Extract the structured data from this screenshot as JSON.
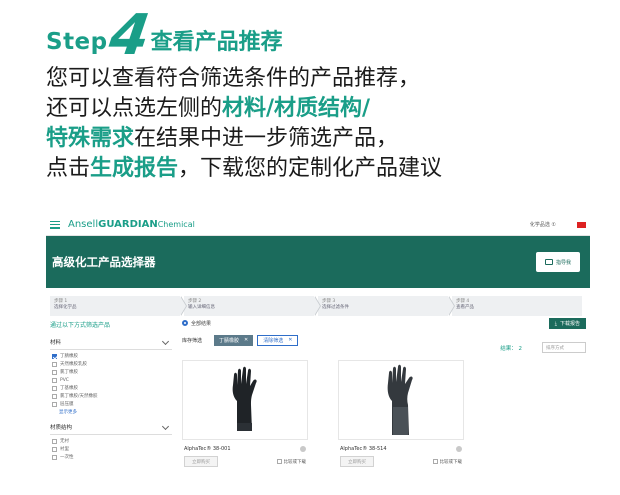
{
  "instruction": {
    "step_word": "Step",
    "step_number": "4",
    "step_title": "查看产品推荐",
    "line1": "您可以查看符合筛选条件的产品推荐，",
    "line2_pre": "还可以点选左侧的",
    "line2_hl": "材料/材质结构/",
    "line3_hl": "特殊需求",
    "line3_post": "在结果中进一步筛选产品，",
    "line4_pre": "点击",
    "line4_hl": "生成报告",
    "line4_post": "，下载您的定制化产品建议",
    "accent_color": "#1a9e88"
  },
  "app": {
    "brand_prefix": "Ansell",
    "brand_bold": "GUARDIAN",
    "brand_suffix": "Chemical",
    "topnav": {
      "language": "化学品选 ①",
      "help": "",
      "account": "",
      "flag_color": "#dd2222"
    },
    "banner": {
      "title": "高级化工产品选择器",
      "button_label": "指导我",
      "color": "#1b6b5c"
    },
    "steps": [
      {
        "num": "步骤 1",
        "label": "选择化学品"
      },
      {
        "num": "步骤 2",
        "label": "输入详细信息"
      },
      {
        "num": "步骤 3",
        "label": "选择过滤条件"
      },
      {
        "num": "步骤 4",
        "label": "查看产品"
      }
    ],
    "sidebar": {
      "header": "通过以下方式筛选产品",
      "sections": [
        {
          "title": "材料",
          "options": [
            {
              "label": "丁腈橡胶",
              "checked": true
            },
            {
              "label": "天然橡胶乳胶",
              "checked": false
            },
            {
              "label": "氯丁橡胶",
              "checked": false
            },
            {
              "label": "PVC",
              "checked": false
            },
            {
              "label": "丁基橡胶",
              "checked": false
            },
            {
              "label": "氯丁橡胶/天然橡胶",
              "checked": false
            },
            {
              "label": "层压膜",
              "checked": false
            }
          ],
          "more_label": "显示更多"
        },
        {
          "title": "材质结构",
          "options": [
            {
              "label": "无衬",
              "checked": false
            },
            {
              "label": "衬里",
              "checked": false
            },
            {
              "label": "一次性",
              "checked": false
            }
          ]
        }
      ]
    },
    "main": {
      "radio_label": "全部结果",
      "download_label": "下载报告",
      "filter_label": "库存筛选",
      "chips": [
        "丁腈橡胶",
        "清除筛选"
      ],
      "result_label": "结果：",
      "result_count": "2",
      "sort_placeholder": "排序方式",
      "products": [
        {
          "name": "AlphaTec® 38-001",
          "detail_button": "立即购买",
          "compare_label": "比较或下载"
        },
        {
          "name": "AlphaTec® 38-514",
          "detail_button": "立即购买",
          "compare_label": "比较或下载"
        }
      ]
    }
  }
}
